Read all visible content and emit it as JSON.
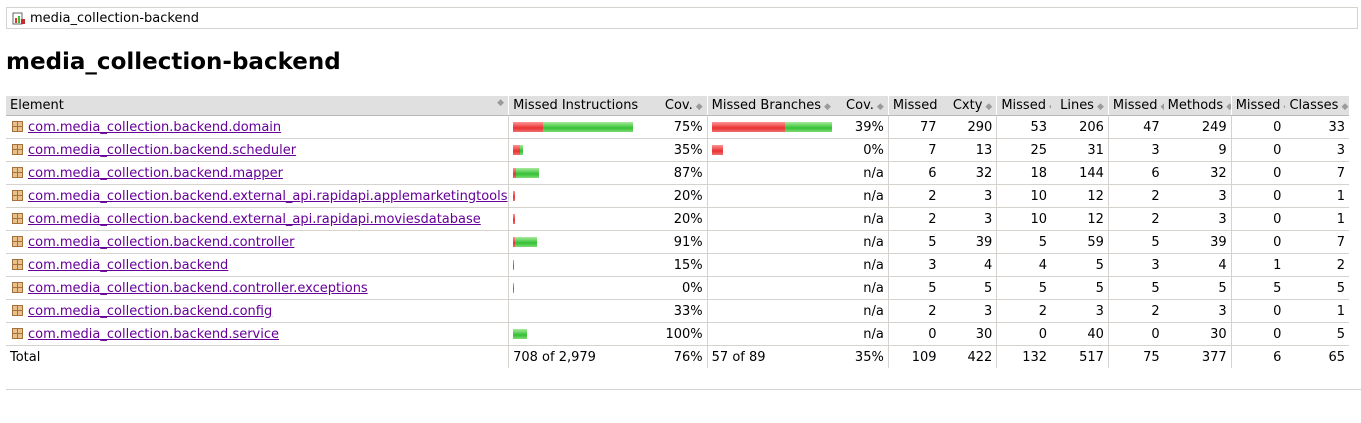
{
  "breadcrumb": {
    "label": "media_collection-backend",
    "icon": "report-icon"
  },
  "page_title": "media_collection-backend",
  "headers": {
    "element": "Element",
    "missed_instructions": "Missed Instructions",
    "cov1": "Cov.",
    "missed_branches": "Missed Branches",
    "cov2": "Cov.",
    "missed_cxty": "Missed",
    "cxty": "Cxty",
    "missed_lines": "Missed",
    "lines": "Lines",
    "missed_methods": "Missed",
    "methods": "Methods",
    "missed_classes": "Missed",
    "classes": "Classes"
  },
  "rows": [
    {
      "name": "com.media_collection.backend.domain",
      "instr_missed_frac": 0.25,
      "instr_bar_scale": 1.0,
      "instr_cov": "75%",
      "branch_missed_frac": 0.61,
      "branch_bar_scale": 1.0,
      "branch_cov": "39%",
      "missed_cxty": "77",
      "cxty": "290",
      "missed_lines": "53",
      "lines": "206",
      "missed_methods": "47",
      "methods": "249",
      "missed_classes": "0",
      "classes": "33"
    },
    {
      "name": "com.media_collection.backend.scheduler",
      "instr_missed_frac": 0.65,
      "instr_bar_scale": 0.08,
      "instr_cov": "35%",
      "branch_missed_frac": 1.0,
      "branch_bar_scale": 0.09,
      "branch_cov": "0%",
      "missed_cxty": "7",
      "cxty": "13",
      "missed_lines": "25",
      "lines": "31",
      "missed_methods": "3",
      "methods": "9",
      "missed_classes": "0",
      "classes": "3"
    },
    {
      "name": "com.media_collection.backend.mapper",
      "instr_missed_frac": 0.13,
      "instr_bar_scale": 0.22,
      "instr_cov": "87%",
      "branch_missed_frac": 0,
      "branch_bar_scale": 0,
      "branch_cov": "n/a",
      "missed_cxty": "6",
      "cxty": "32",
      "missed_lines": "18",
      "lines": "144",
      "missed_methods": "6",
      "methods": "32",
      "missed_classes": "0",
      "classes": "7"
    },
    {
      "name": "com.media_collection.backend.external_api.rapidapi.applemarketingtools",
      "instr_missed_frac": 0.8,
      "instr_bar_scale": 0.02,
      "instr_cov": "20%",
      "branch_missed_frac": 0,
      "branch_bar_scale": 0,
      "branch_cov": "n/a",
      "missed_cxty": "2",
      "cxty": "3",
      "missed_lines": "10",
      "lines": "12",
      "missed_methods": "2",
      "methods": "3",
      "missed_classes": "0",
      "classes": "1"
    },
    {
      "name": "com.media_collection.backend.external_api.rapidapi.moviesdatabase",
      "instr_missed_frac": 0.8,
      "instr_bar_scale": 0.02,
      "instr_cov": "20%",
      "branch_missed_frac": 0,
      "branch_bar_scale": 0,
      "branch_cov": "n/a",
      "missed_cxty": "2",
      "cxty": "3",
      "missed_lines": "10",
      "lines": "12",
      "missed_methods": "2",
      "methods": "3",
      "missed_classes": "0",
      "classes": "1"
    },
    {
      "name": "com.media_collection.backend.controller",
      "instr_missed_frac": 0.09,
      "instr_bar_scale": 0.2,
      "instr_cov": "91%",
      "branch_missed_frac": 0,
      "branch_bar_scale": 0,
      "branch_cov": "n/a",
      "missed_cxty": "5",
      "cxty": "39",
      "missed_lines": "5",
      "lines": "59",
      "missed_methods": "5",
      "methods": "39",
      "missed_classes": "0",
      "classes": "7"
    },
    {
      "name": "com.media_collection.backend",
      "instr_missed_frac": 0.85,
      "instr_bar_scale": 0.01,
      "instr_cov": "15%",
      "branch_missed_frac": 0,
      "branch_bar_scale": 0,
      "branch_cov": "n/a",
      "missed_cxty": "3",
      "cxty": "4",
      "missed_lines": "4",
      "lines": "5",
      "missed_methods": "3",
      "methods": "4",
      "missed_classes": "1",
      "classes": "2"
    },
    {
      "name": "com.media_collection.backend.controller.exceptions",
      "instr_missed_frac": 1.0,
      "instr_bar_scale": 0.01,
      "instr_cov": "0%",
      "branch_missed_frac": 0,
      "branch_bar_scale": 0,
      "branch_cov": "n/a",
      "missed_cxty": "5",
      "cxty": "5",
      "missed_lines": "5",
      "lines": "5",
      "missed_methods": "5",
      "methods": "5",
      "missed_classes": "5",
      "classes": "5"
    },
    {
      "name": "com.media_collection.backend.config",
      "instr_missed_frac": 0,
      "instr_bar_scale": 0,
      "instr_cov": "33%",
      "branch_missed_frac": 0,
      "branch_bar_scale": 0,
      "branch_cov": "n/a",
      "missed_cxty": "2",
      "cxty": "3",
      "missed_lines": "2",
      "lines": "3",
      "missed_methods": "2",
      "methods": "3",
      "missed_classes": "0",
      "classes": "1"
    },
    {
      "name": "com.media_collection.backend.service",
      "instr_missed_frac": 0,
      "instr_bar_scale": 0.12,
      "instr_cov": "100%",
      "branch_missed_frac": 0,
      "branch_bar_scale": 0,
      "branch_cov": "n/a",
      "missed_cxty": "0",
      "cxty": "30",
      "missed_lines": "0",
      "lines": "40",
      "missed_methods": "0",
      "methods": "30",
      "missed_classes": "0",
      "classes": "5"
    }
  ],
  "total": {
    "label": "Total",
    "instructions": "708 of 2,979",
    "instr_cov": "76%",
    "branches": "57 of 89",
    "branch_cov": "35%",
    "missed_cxty": "109",
    "cxty": "422",
    "missed_lines": "132",
    "lines": "517",
    "missed_methods": "75",
    "methods": "377",
    "missed_classes": "6",
    "classes": "65"
  },
  "colors": {
    "missed": "#e83232",
    "covered": "#34c034",
    "link": "#660099",
    "header_bg": "#e0e0e0"
  }
}
